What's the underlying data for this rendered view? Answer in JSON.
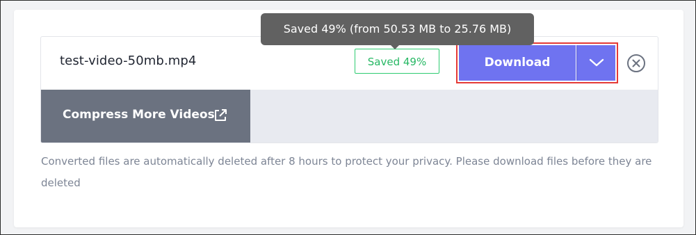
{
  "file": {
    "name": "test-video-50mb.mp4",
    "saved_badge": "Saved 49%",
    "saved_percent": 49
  },
  "tooltip": {
    "text": "Saved 49% (from 50.53 MB to 25.76 MB)"
  },
  "actions": {
    "download_label": "Download",
    "dropdown_icon": "chevron-down-icon",
    "remove_icon": "close-circle-icon",
    "compress_more_label": "Compress More Videos",
    "compress_more_icon": "external-link-icon"
  },
  "note": {
    "text": "Converted files are automatically deleted after 8 hours to protect your privacy. Please download files before they are deleted"
  },
  "colors": {
    "accent": "#6f73f0",
    "success": "#27b864",
    "highlight": "#e53935",
    "secondary_button": "#6b7280",
    "tooltip_bg": "#616161"
  }
}
